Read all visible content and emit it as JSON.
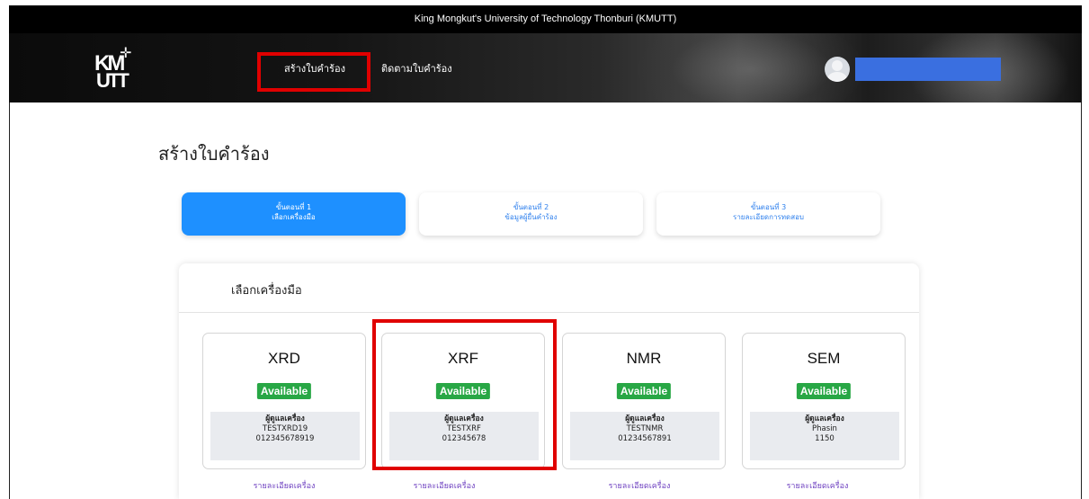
{
  "header": {
    "university": "King Mongkut's University of Technology Thonburi (KMUTT)",
    "logo_line1": "KM",
    "logo_line2": "UTT"
  },
  "nav": {
    "create_request": "สร้างใบคำร้อง",
    "track_request": "ติดตามใบคำร้อง"
  },
  "page": {
    "title": "สร้างใบคำร้อง"
  },
  "steps": [
    {
      "label": "ขั้นตอนที่ 1",
      "desc": "เลือกเครื่องมือ",
      "active": true
    },
    {
      "label": "ขั้นตอนที่ 2",
      "desc": "ข้อมูลผู้ยื่นคำร้อง",
      "active": false
    },
    {
      "label": "ขั้นตอนที่ 3",
      "desc": "รายละเอียดการทดสอบ",
      "active": false
    }
  ],
  "panel": {
    "title": "เลือกเครื่องมือ"
  },
  "instruments": [
    {
      "name": "XRD",
      "status": "Available",
      "caretaker_label": "ผู้ดูแลเครื่อง",
      "caretaker": "TESTXRD19",
      "phone": "012345678919",
      "detail": "รายละเอียดเครื่อง"
    },
    {
      "name": "XRF",
      "status": "Available",
      "caretaker_label": "ผู้ดูแลเครื่อง",
      "caretaker": "TESTXRF",
      "phone": "012345678",
      "detail": "รายละเอียดเครื่อง"
    },
    {
      "name": "NMR",
      "status": "Available",
      "caretaker_label": "ผู้ดูแลเครื่อง",
      "caretaker": "TESTNMR",
      "phone": "01234567891",
      "detail": "รายละเอียดเครื่อง"
    },
    {
      "name": "SEM",
      "status": "Available",
      "caretaker_label": "ผู้ดูแลเครื่อง",
      "caretaker": "Phasin",
      "phone": "1150",
      "detail": "รายละเอียดเครื่อง"
    }
  ],
  "colors": {
    "primary": "#1e90ff",
    "available": "#28a745",
    "highlight": "#e00000",
    "link": "#6f42c1"
  }
}
